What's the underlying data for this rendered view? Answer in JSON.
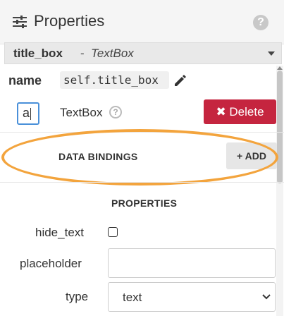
{
  "header": {
    "title": "Properties",
    "help_icon": "?"
  },
  "selector": {
    "component_name": "title_box",
    "separator": "-",
    "component_type": "TextBox"
  },
  "name_row": {
    "label": "name",
    "value": "self.title_box"
  },
  "component_row": {
    "icon_text": "a",
    "type_label": "TextBox",
    "help_icon": "?",
    "delete_label": "✖ Delete"
  },
  "data_bindings": {
    "label": "DATA BINDINGS",
    "add_label": "+ ADD"
  },
  "properties": {
    "label": "PROPERTIES",
    "hide_text_label": "hide_text",
    "hide_text_checked": false,
    "placeholder_label": "placeholder",
    "placeholder_value": "",
    "type_label": "type",
    "type_value": "text"
  },
  "colors": {
    "delete_button": "#c5253f",
    "highlight_ellipse": "#f3a43d",
    "focus_border": "#4a90d9"
  }
}
